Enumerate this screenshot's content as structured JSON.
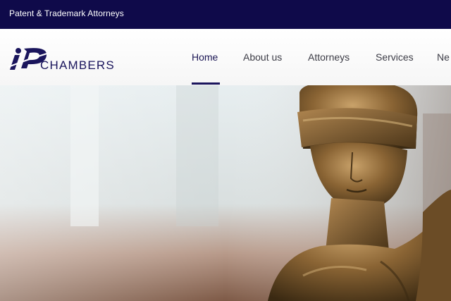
{
  "topbar": {
    "tagline": "Patent & Trademark Attorneys"
  },
  "logo": {
    "text": "CHAMBERS"
  },
  "nav": {
    "items": [
      {
        "label": "Home",
        "active": true
      },
      {
        "label": "About us"
      },
      {
        "label": "Attorneys"
      },
      {
        "label": "Services"
      },
      {
        "label": "Ne"
      }
    ]
  },
  "colors": {
    "topbar": "#0f0a4a",
    "brand": "#1a155c",
    "nav_text": "#3c3c46"
  },
  "hero": {
    "image": "blindfolded-lady-justice-statue"
  }
}
